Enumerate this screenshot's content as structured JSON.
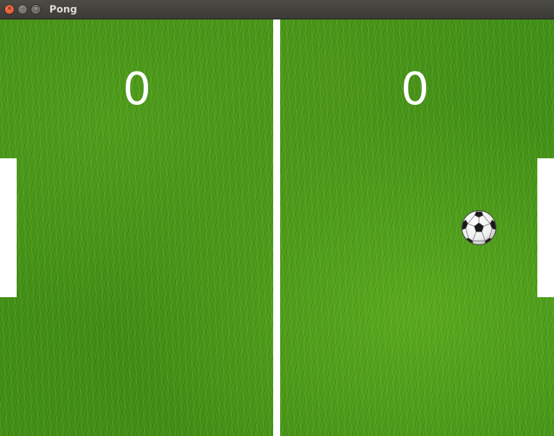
{
  "window": {
    "title": "Pong",
    "buttons": {
      "close_icon": "close-icon",
      "minimize_icon": "minimize-icon",
      "maximize_icon": "maximize-icon"
    }
  },
  "game": {
    "score_left": "0",
    "score_right": "0",
    "colors": {
      "field": "#3f8e17",
      "net": "#ffffff",
      "paddles": "#ffffff",
      "score_text": "#ffffff",
      "titlebar": "#3c3b37",
      "close_button": "#e4542b"
    },
    "ball_icon": "soccer-ball-icon"
  }
}
